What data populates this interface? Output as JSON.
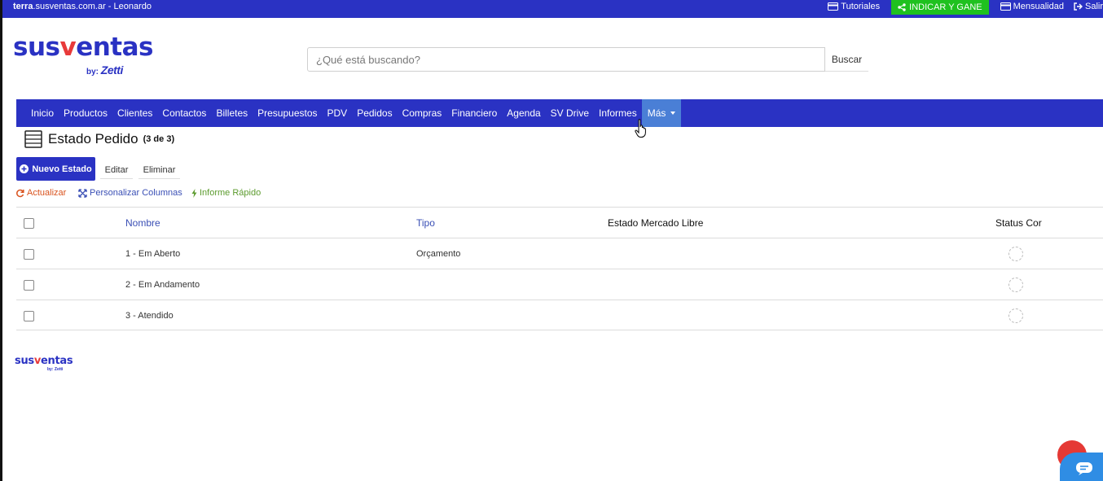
{
  "topbar": {
    "site_bold": "terra",
    "site_rest": ".susventas.com.ar - Leonardo",
    "tutoriales": "Tutoriales",
    "indicar": "INDICAR Y GANE",
    "mensualidad": "Mensualidad",
    "salir": "Salir",
    "colors": {
      "bar": "#2a32c3",
      "indicar": "#1fc11f"
    }
  },
  "logo": {
    "part1": "sus",
    "part2": "v",
    "part3": "entas",
    "by": "by:",
    "brand": "Zetti"
  },
  "search": {
    "placeholder": "¿Qué está buscando?",
    "value": "",
    "button": "Buscar"
  },
  "nav": {
    "items": [
      {
        "label": "Inicio"
      },
      {
        "label": "Productos"
      },
      {
        "label": "Clientes"
      },
      {
        "label": "Contactos"
      },
      {
        "label": "Billetes"
      },
      {
        "label": "Presupuestos"
      },
      {
        "label": "PDV"
      },
      {
        "label": "Pedidos"
      },
      {
        "label": "Compras"
      },
      {
        "label": "Financiero"
      },
      {
        "label": "Agenda"
      },
      {
        "label": "SV Drive"
      },
      {
        "label": "Informes"
      },
      {
        "label": "Más"
      }
    ],
    "active_color": "#4a7fd6"
  },
  "page": {
    "title": "Estado Pedido",
    "count": "(3 de 3)"
  },
  "actions": {
    "nuevo": "Nuevo Estado",
    "editar": "Editar",
    "eliminar": "Eliminar"
  },
  "tools": {
    "actualizar": "Actualizar",
    "personalizar": "Personalizar Columnas",
    "informe": "Informe Rápido"
  },
  "table": {
    "columns": [
      "Nombre",
      "Tipo",
      "Estado Mercado Libre",
      "Status Cor"
    ],
    "rows": [
      {
        "nombre": "1 - Em Aberto",
        "tipo": "Orçamento",
        "ml": "",
        "cor": ""
      },
      {
        "nombre": "2 - Em Andamento",
        "tipo": "",
        "ml": "",
        "cor": ""
      },
      {
        "nombre": "3 - Atendido",
        "tipo": "",
        "ml": "",
        "cor": ""
      }
    ]
  },
  "footer": {
    "part1": "sus",
    "part2": "v",
    "part3": "entas",
    "by": "by: Zetti"
  },
  "icons": [
    "card-icon",
    "share-icon",
    "signout-icon",
    "server-icon",
    "plus-circle-icon",
    "refresh-icon",
    "expand-icon",
    "bolt-icon",
    "hand-cursor-icon",
    "chat-icon"
  ]
}
